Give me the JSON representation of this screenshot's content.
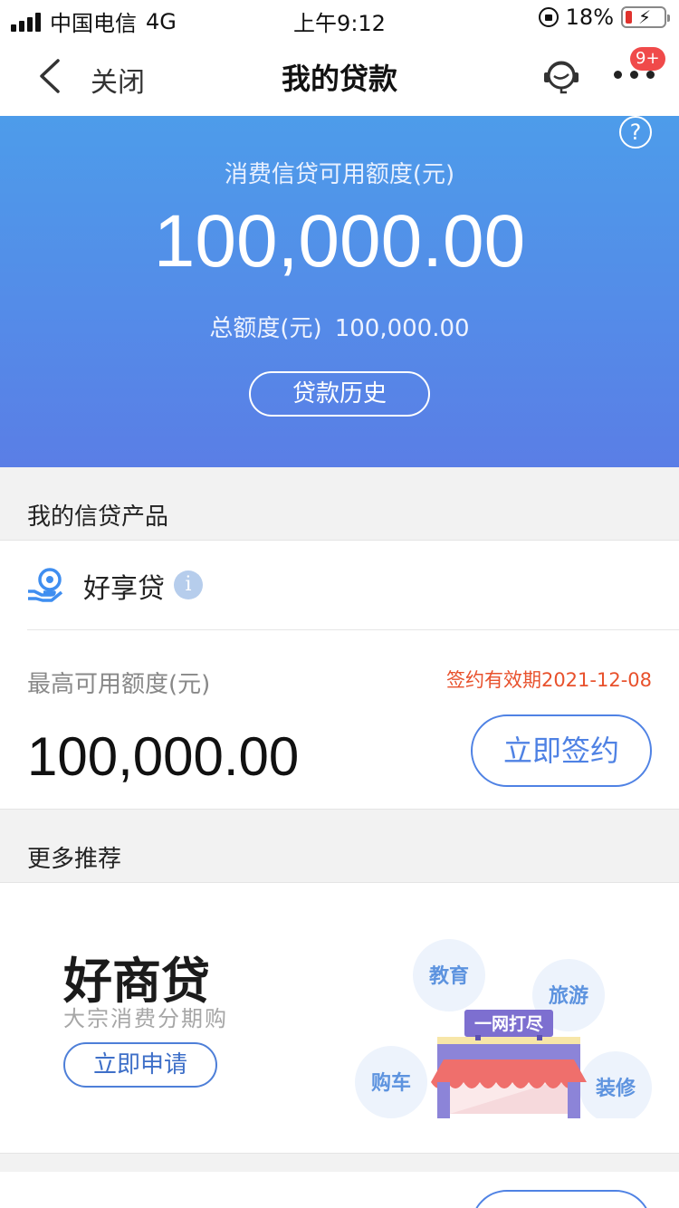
{
  "status_bar": {
    "carrier": "中国电信",
    "network": "4G",
    "time": "上午9:12",
    "battery": "18%",
    "battery_level": 0.18
  },
  "nav": {
    "close_label": "关闭",
    "title": "我的贷款",
    "badge": "9+"
  },
  "hero": {
    "help": "?",
    "available_label": "消费信贷可用额度(元)",
    "available_amount": "100,000.00",
    "total_label": "总额度(元)",
    "total_amount": "100,000.00",
    "history_button": "贷款历史"
  },
  "products_section": {
    "title": "我的信贷产品"
  },
  "product": {
    "name": "好享贷",
    "info": "i",
    "max_label": "最高可用额度(元)",
    "validity": "签约有效期2021-12-08",
    "max_amount": "100,000.00",
    "sign_button": "立即签约"
  },
  "recommend_section": {
    "title": "更多推荐"
  },
  "promo": {
    "title": "好商贷",
    "subtitle": "大宗消费分期购",
    "apply_button": "立即申请",
    "banner": "一网打尽",
    "bubbles": [
      "教育",
      "旅游",
      "购车",
      "装修"
    ]
  },
  "colors": {
    "accent": "#4f82e4",
    "hero_top": "#4d9cea",
    "hero_bottom": "#5a7ee6",
    "validity": "#e8512c",
    "badge": "#f04a4a"
  }
}
